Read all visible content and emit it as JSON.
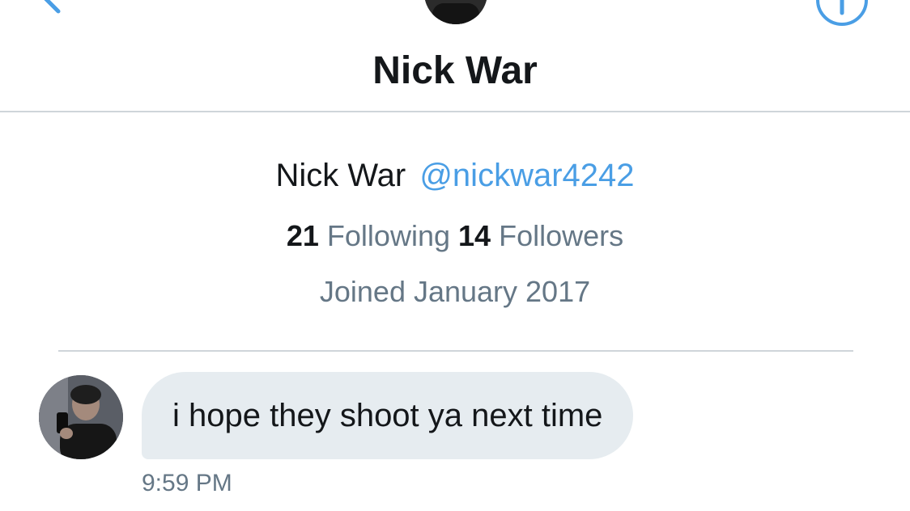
{
  "header": {
    "title": "Nick War"
  },
  "profile": {
    "name": "Nick War",
    "handle": "@nickwar4242",
    "following_count": "21",
    "following_label": "Following",
    "followers_count": "14",
    "followers_label": "Followers",
    "joined": "Joined January 2017"
  },
  "messages": [
    {
      "text": "i hope they shoot ya next time",
      "time": "9:59 PM"
    }
  ],
  "colors": {
    "accent": "#4a9ee5",
    "bubble": "#e6ecf0",
    "muted_text": "#657786",
    "divider": "#cfd5da"
  },
  "icons": {
    "back": "chevron-left-icon",
    "info": "info-icon"
  }
}
